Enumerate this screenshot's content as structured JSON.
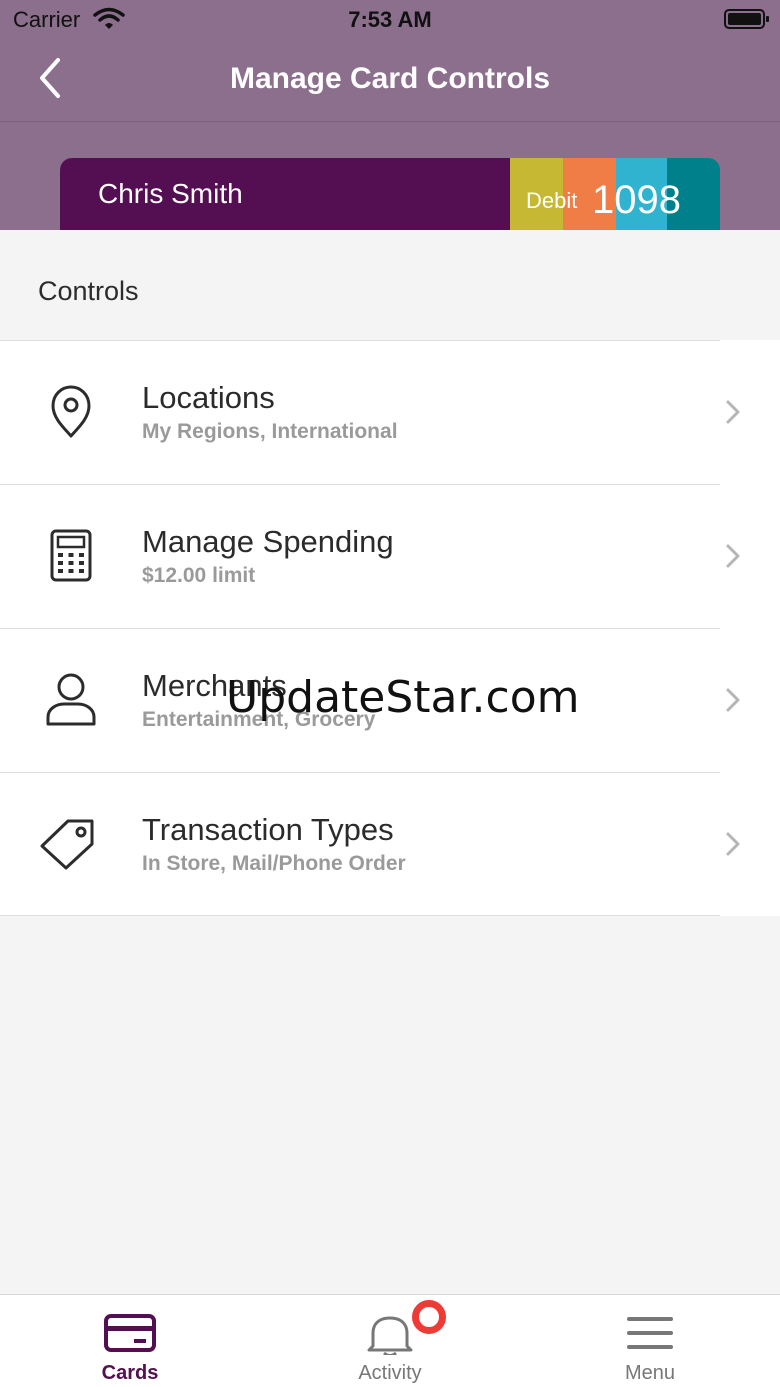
{
  "status_bar": {
    "carrier": "Carrier",
    "time": "7:53 AM"
  },
  "nav": {
    "title": "Manage Card Controls",
    "back_icon": "chevron-left-icon"
  },
  "card": {
    "name": "Chris Smith",
    "type": "Debit",
    "last4": "1098",
    "colors": {
      "main": "#540f52",
      "stripes": [
        "#c6b833",
        "#f07d45",
        "#2fb3cf",
        "#00808a"
      ]
    }
  },
  "section": {
    "title": "Controls"
  },
  "controls": [
    {
      "label": "Locations",
      "subtitle": "My Regions, International",
      "icon": "location-pin-icon"
    },
    {
      "label": "Manage Spending",
      "subtitle": "$12.00 limit",
      "icon": "calculator-icon"
    },
    {
      "label": "Merchants",
      "subtitle": "Entertainment, Grocery",
      "icon": "person-icon"
    },
    {
      "label": "Transaction Types",
      "subtitle": "In Store, Mail/Phone Order",
      "icon": "tag-icon"
    }
  ],
  "watermark": "UpdateStar.com",
  "tabs": [
    {
      "label": "Cards",
      "icon": "card-icon",
      "active": true
    },
    {
      "label": "Activity",
      "icon": "bell-icon",
      "active": false
    },
    {
      "label": "Menu",
      "icon": "hamburger-menu-icon",
      "active": false
    }
  ],
  "colors": {
    "header": "#8b6f8c",
    "accent": "#540f52",
    "badge": "#ef3b35"
  }
}
